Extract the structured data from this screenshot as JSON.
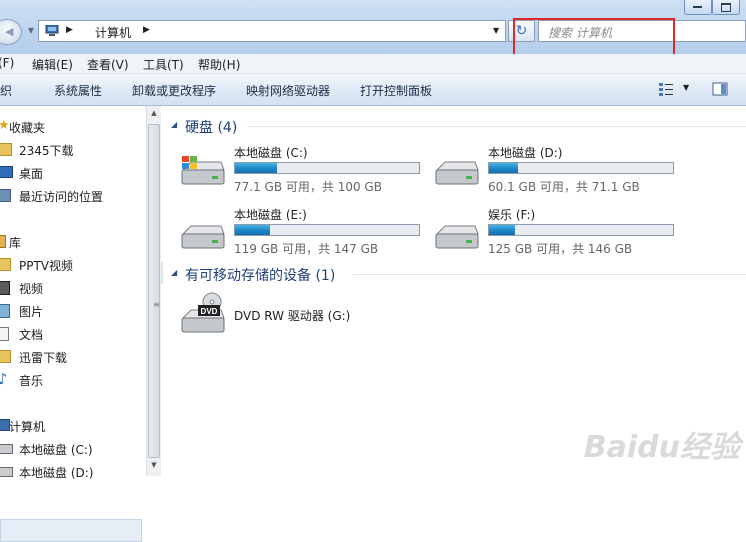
{
  "address": {
    "crumb": "计算机",
    "search_placeholder": "搜索 计算机"
  },
  "menu": [
    {
      "label": "(F)"
    },
    {
      "label": "编辑(E)"
    },
    {
      "label": "查看(V)"
    },
    {
      "label": "工具(T)"
    },
    {
      "label": "帮助(H)"
    }
  ],
  "commands": [
    {
      "label": "织"
    },
    {
      "label": "系统属性"
    },
    {
      "label": "卸载或更改程序"
    },
    {
      "label": "映射网络驱动器"
    },
    {
      "label": "打开控制面板"
    }
  ],
  "nav": [
    {
      "label": "收藏夹",
      "icon": "star-icon"
    },
    {
      "label": "2345下载",
      "icon": "folder-icon"
    },
    {
      "label": "桌面",
      "icon": "desktop-icon"
    },
    {
      "label": "最近访问的位置",
      "icon": "recent-places-icon"
    },
    {
      "label": "库",
      "icon": "library-icon"
    },
    {
      "label": "PPTV视频",
      "icon": "folder-icon"
    },
    {
      "label": "视频",
      "icon": "video-library-icon"
    },
    {
      "label": "图片",
      "icon": "picture-library-icon"
    },
    {
      "label": "文档",
      "icon": "document-library-icon"
    },
    {
      "label": "迅雷下载",
      "icon": "folder-icon"
    },
    {
      "label": "音乐",
      "icon": "music-icon"
    },
    {
      "label": "计算机",
      "icon": "computer-icon",
      "selected": true
    },
    {
      "label": "本地磁盘 (C:)",
      "icon": "windows-drive-icon"
    },
    {
      "label": "本地磁盘 (D:)",
      "icon": "hard-drive-icon"
    }
  ],
  "groups": {
    "hdd": {
      "title": "硬盘 (4)"
    },
    "removable": {
      "title": "有可移动存储的设备 (1)"
    }
  },
  "drives": [
    {
      "name": "本地磁盘 (C:)",
      "free": "77.1 GB 可用，共 100 GB",
      "used_fraction": 0.23,
      "icon": "windows-drive-icon"
    },
    {
      "name": "本地磁盘 (D:)",
      "free": "60.1 GB 可用，共 71.1 GB",
      "used_fraction": 0.16,
      "icon": "hard-drive-icon"
    },
    {
      "name": "本地磁盘 (E:)",
      "free": "119 GB 可用，共 147 GB",
      "used_fraction": 0.19,
      "icon": "hard-drive-icon"
    },
    {
      "name": "娱乐 (F:)",
      "free": "125 GB 可用，共 146 GB",
      "used_fraction": 0.14,
      "icon": "hard-drive-icon"
    }
  ],
  "dvd": {
    "name": "DVD RW 驱动器 (G:)",
    "badge": "DVD",
    "icon": "dvd-drive-icon"
  },
  "watermark": "Baidu经验",
  "colors": {
    "usage_bar": "#1f88c9",
    "group_title": "#1e3f7a",
    "highlight_box": "#e02828"
  }
}
